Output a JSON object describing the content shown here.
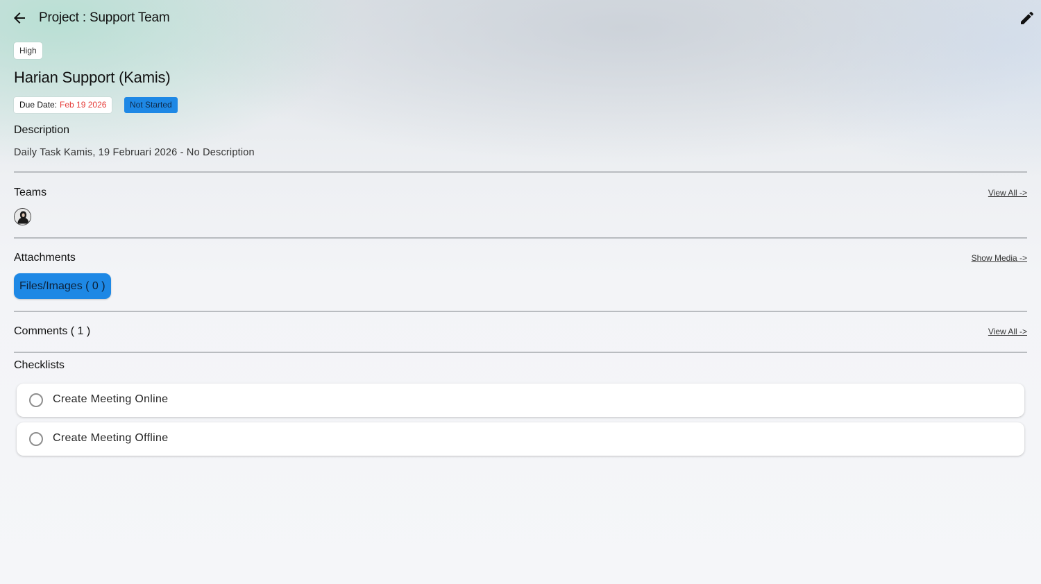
{
  "header": {
    "back_icon": "arrow-left-icon",
    "title": "Project : Support Team",
    "edit_icon": "pencil-icon"
  },
  "task": {
    "priority": "High",
    "title": "Harian Support (Kamis)",
    "due_label": "Due Date:",
    "due_value": "Feb 19 2026",
    "status": "Not Started"
  },
  "description": {
    "heading": "Description",
    "text": "Daily Task Kamis, 19 Februari 2026 - No Description"
  },
  "teams": {
    "heading": "Teams",
    "view_all": "View All ->"
  },
  "attachments": {
    "heading": "Attachments",
    "show_media": "Show Media ->",
    "files_label": "Files/Images ( 0 )"
  },
  "comments": {
    "heading": "Comments ( 1 )",
    "view_all": "View All ->"
  },
  "checklists": {
    "heading": "Checklists",
    "items": [
      {
        "label": "Create Meeting Online",
        "checked": false
      },
      {
        "label": "Create Meeting Offline",
        "checked": false
      }
    ]
  },
  "colors": {
    "accent": "#1e88e5",
    "due_date": "#e53935",
    "divider": "#b9bcc0"
  }
}
